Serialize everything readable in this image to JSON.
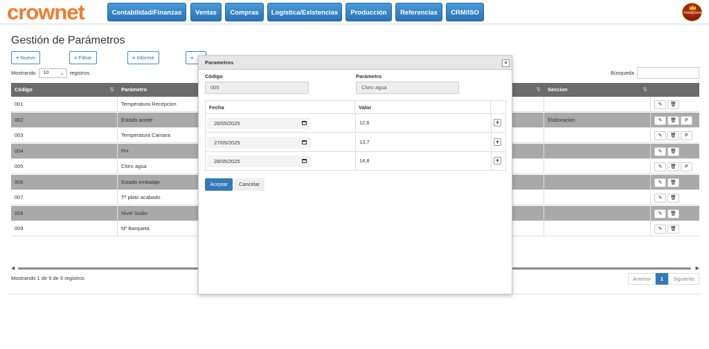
{
  "app": {
    "logo": "crownet",
    "badge_text": "FoodCircle"
  },
  "nav": [
    "Contabilidad/Finanzas",
    "Ventas",
    "Compras",
    "Logística/Existencias",
    "Producción",
    "Referencias",
    "CRM/ISO"
  ],
  "page": {
    "title": "Gestión de Parámetros"
  },
  "toolbar": {
    "new_label": "Nuevo",
    "filter_label": "Filtrar",
    "report_label": "Informe"
  },
  "length": {
    "prefix": "Mostrando",
    "value": "10",
    "suffix": "registros"
  },
  "search": {
    "label": "Búsqueda",
    "value": ""
  },
  "table": {
    "headers": {
      "code": "Código",
      "param": "Parámetro",
      "section": "Seccion"
    },
    "rows": [
      {
        "code": "001",
        "param": "Temperatura Recepcion",
        "section": "",
        "p": false
      },
      {
        "code": "002",
        "param": "Estado aceite",
        "section": "Elaboracion",
        "p": true
      },
      {
        "code": "003",
        "param": "Temperatura Camara",
        "section": "",
        "p": true
      },
      {
        "code": "004",
        "param": "PH",
        "section": "",
        "p": false
      },
      {
        "code": "005",
        "param": "Cloro agua",
        "section": "",
        "p": true
      },
      {
        "code": "006",
        "param": "Estado embalaje",
        "section": "",
        "p": false
      },
      {
        "code": "007",
        "param": "Tª plato acabado",
        "section": "",
        "p": false
      },
      {
        "code": "008",
        "param": "Nivel Sodio",
        "section": "",
        "p": false
      },
      {
        "code": "009",
        "param": "Nº Barqueta",
        "section": "",
        "p": false
      }
    ],
    "p_label": "P"
  },
  "info": "Mostrando 1 de 9 de 9 registros",
  "pager": {
    "prev": "Anterior",
    "current": "1",
    "next": "Siguiente"
  },
  "modal": {
    "title": "Parametros",
    "close": "×",
    "code_label": "Código",
    "code_value": "005",
    "param_label": "Parámetro",
    "param_value": "Cloro agua",
    "col_date": "Fecha",
    "col_value": "Valor",
    "rows": [
      {
        "date": "26/05/2025",
        "value": "12,6"
      },
      {
        "date": "27/05/2025",
        "value": "13,7"
      },
      {
        "date": "28/05/2025",
        "value": "14,8"
      }
    ],
    "accept": "Aceptar",
    "cancel": "Cancelar"
  }
}
